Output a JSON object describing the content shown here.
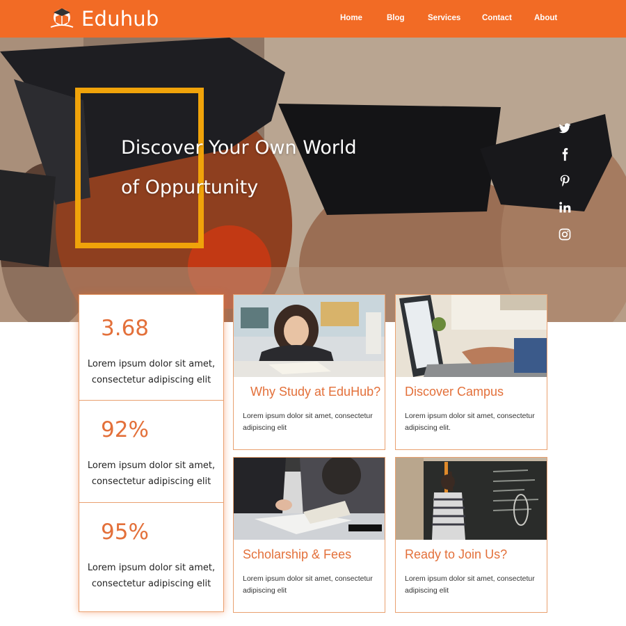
{
  "header": {
    "brand": "Eduhub",
    "logo_icon": "book-hat-logo",
    "nav": [
      {
        "label": "Home"
      },
      {
        "label": "Blog"
      },
      {
        "label": "Services"
      },
      {
        "label": "Contact"
      },
      {
        "label": "About"
      }
    ],
    "background_color": "#f26b25"
  },
  "hero": {
    "headline_line1": "Discover Your Own World",
    "headline_line2": "of Oppurtunity",
    "frame_color": "#f0a30a",
    "social_icons": [
      "twitter-icon",
      "facebook-icon",
      "pinterest-icon",
      "linkedin-icon",
      "instagram-icon"
    ]
  },
  "stats": [
    {
      "value": "3.68",
      "line1": "Lorem ipsum dolor sit amet,",
      "line2": "consectetur adipiscing elit"
    },
    {
      "value": "92%",
      "line1": "Lorem ipsum dolor sit amet,",
      "line2": "consectetur adipiscing elit"
    },
    {
      "value": "95%",
      "line1": "Lorem ipsum dolor sit amet,",
      "line2": "consectetur adipiscing elit"
    }
  ],
  "cards": [
    {
      "title": "Why Study at EduHub?",
      "text": "Lorem ipsum dolor sit amet, consectetur adipiscing elit"
    },
    {
      "title": "Discover Campus",
      "text": "Lorem ipsum dolor sit amet, consectetur adipiscing elit."
    },
    {
      "title": "Scholarship & Fees",
      "text": "Lorem ipsum dolor sit amet, consectetur adipiscing elit"
    },
    {
      "title": "Ready to Join Us?",
      "text": "Lorem ipsum dolor sit amet, consectetur adipiscing elit"
    }
  ],
  "accent_color": "#e3703a"
}
